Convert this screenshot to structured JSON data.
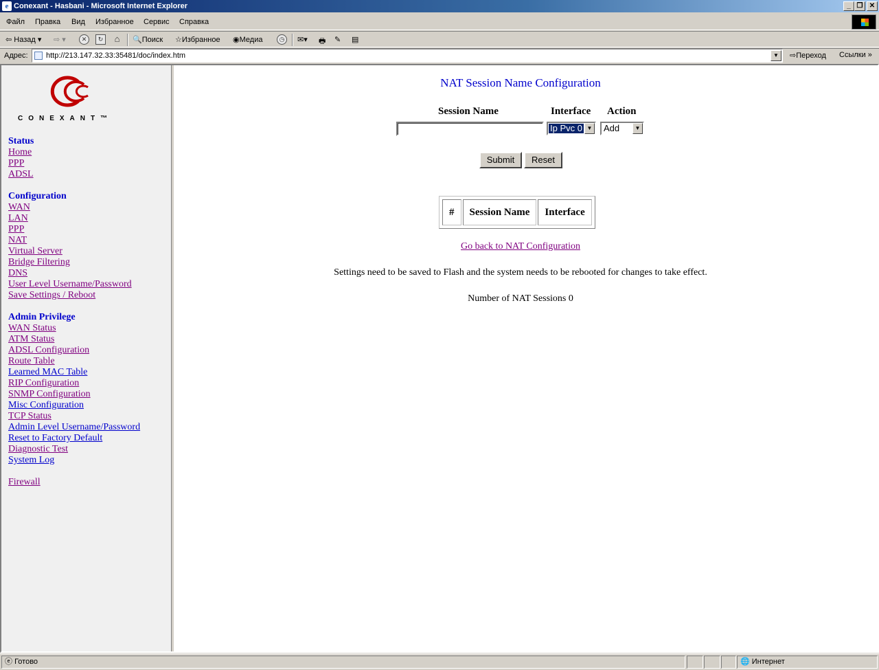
{
  "window": {
    "title": "Conexant - Hasbani - Microsoft Internet Explorer",
    "controls": [
      "_",
      "❐",
      "✕"
    ]
  },
  "menu": [
    "Файл",
    "Правка",
    "Вид",
    "Избранное",
    "Сервис",
    "Справка"
  ],
  "toolbar": {
    "back": "Назад",
    "search": "Поиск",
    "favorites": "Избранное",
    "media": "Медиа"
  },
  "address": {
    "label": "Адрес:",
    "url": "http://213.147.32.33:35481/doc/index.htm",
    "go": "Переход",
    "links": "Ссылки"
  },
  "sidebar": {
    "logo_text": "CONEXANT™",
    "status_heading": "Status",
    "status_links": [
      "Home",
      "PPP",
      "ADSL"
    ],
    "config_heading": "Configuration",
    "config_links": [
      "WAN",
      "LAN",
      "PPP",
      "NAT",
      "Virtual Server",
      "Bridge Filtering",
      "DNS",
      "User Level Username/Password",
      "Save Settings / Reboot"
    ],
    "admin_heading": "Admin Privilege",
    "admin_links": [
      "WAN Status",
      "ATM Status",
      "ADSL Configuration",
      "Route Table",
      "Learned MAC Table",
      "RIP Configuration",
      "SNMP Configuration",
      "Misc Configuration",
      "TCP Status",
      "Admin Level Username/Password",
      "Reset to Factory Default",
      "Diagnostic Test",
      "System Log"
    ],
    "firewall": "Firewall"
  },
  "main": {
    "title": "NAT Session Name Configuration",
    "col_session_name": "Session Name",
    "col_interface": "Interface",
    "col_action": "Action",
    "session_name_value": "",
    "interface_value": "Ip Pvc 0",
    "action_value": "Add",
    "submit": "Submit",
    "reset": "Reset",
    "table_headers": [
      "#",
      "Session Name",
      "Interface"
    ],
    "back_link": "Go back to NAT Configuration",
    "notice": "Settings need to be saved to Flash and the system needs to be rebooted for changes to take effect.",
    "count_text": "Number of NAT Sessions 0"
  },
  "status": {
    "text": "Готово",
    "zone": "Интернет"
  }
}
